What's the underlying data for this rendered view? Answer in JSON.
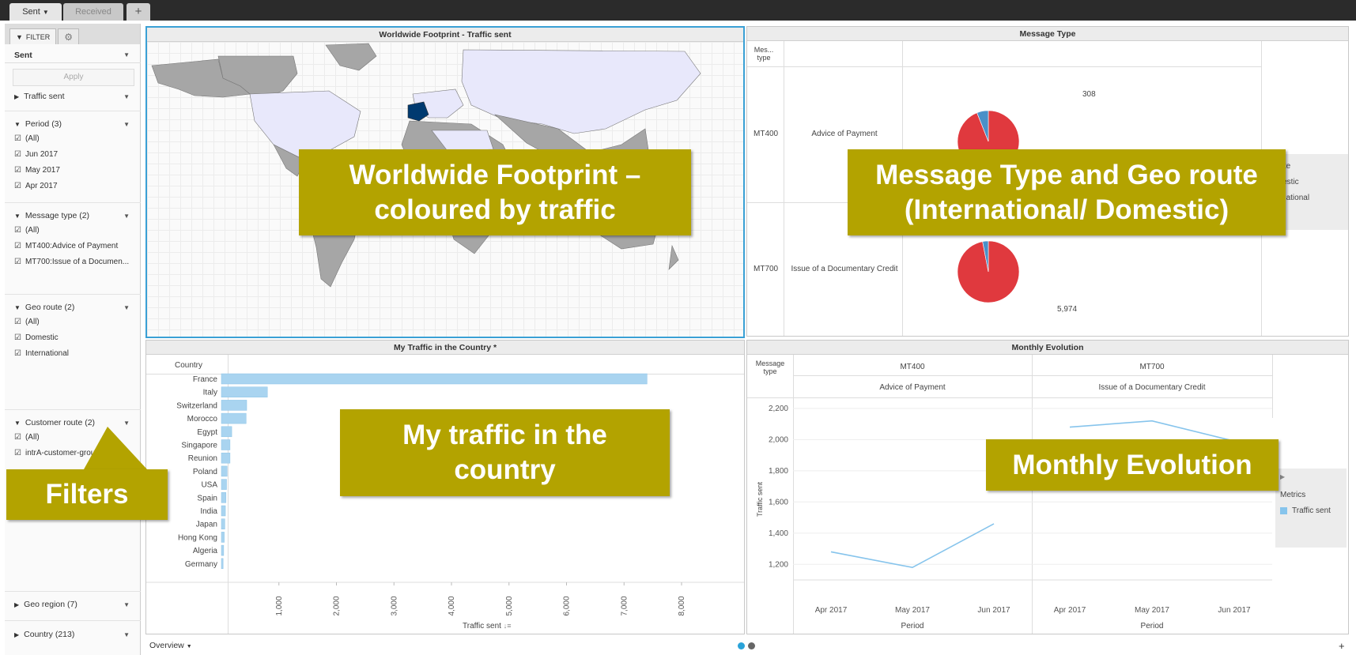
{
  "tabs": {
    "sent": "Sent",
    "received": "Received",
    "add": "+"
  },
  "filter_panel": {
    "tab_label": "FILTER",
    "selector_value": "Sent",
    "apply_label": "Apply",
    "traffic_sent": "Traffic sent",
    "period": {
      "title": "Period (3)",
      "items": [
        "(All)",
        "Jun 2017",
        "May 2017",
        "Apr 2017"
      ]
    },
    "message_type": {
      "title": "Message type (2)",
      "items": [
        "(All)",
        "MT400:Advice of Payment",
        "MT700:Issue of a Documen..."
      ]
    },
    "geo_route": {
      "title": "Geo route (2)",
      "items": [
        "(All)",
        "Domestic",
        "International"
      ]
    },
    "customer_route": {
      "title": "Customer route (2)",
      "items": [
        "(All)",
        "intrA-customer-group"
      ]
    },
    "geo_region": "Geo region (7)",
    "country": "Country (213)"
  },
  "map_panel": {
    "title": "Worldwide Footprint - Traffic sent",
    "highlight_color": "#003a70",
    "land_color": "#a6a6a6",
    "visited_color": "#e8e8fb"
  },
  "message_panel": {
    "title": "Message Type",
    "col_header": "Mes... type",
    "rows": [
      {
        "code": "MT400",
        "name": "Advice of Payment",
        "label": "308"
      },
      {
        "code": "MT700",
        "name": "Issue of a Documentary Credit",
        "label": "5,974"
      }
    ],
    "legend_title": "o route",
    "legend": [
      "Domestic",
      "International"
    ],
    "colors": {
      "international": "#e0393e",
      "domestic": "#4a90c8"
    }
  },
  "country_panel": {
    "title": "My Traffic in the Country *",
    "col_header": "Country",
    "x_title": "Traffic sent",
    "sort_icon": "↓≡",
    "bar_color": "#a9d4f0"
  },
  "monthly_panel": {
    "title": "Monthly Evolution",
    "col_header": "Message type",
    "groups": [
      {
        "code": "MT400",
        "name": "Advice of Payment"
      },
      {
        "code": "MT700",
        "name": "Issue of a Documentary Credit"
      }
    ],
    "y_title": "Traffic sent",
    "period_label": "Period",
    "legend_title": "Metrics",
    "legend_item": "Traffic sent",
    "line_color": "#86c4ec"
  },
  "callouts": {
    "map": "Worldwide Footprint – coloured by traffic",
    "message": "Message Type and Geo route (International/ Domestic)",
    "country": "My traffic in the country",
    "monthly": "Monthly Evolution",
    "filters": "Filters"
  },
  "footer": {
    "overview": "Overview",
    "add": "+"
  },
  "chart_data": [
    {
      "type": "bar",
      "title": "My Traffic in the Country *",
      "xlabel": "Traffic sent",
      "ylabel": "Country",
      "orientation": "horizontal",
      "categories": [
        "France",
        "Italy",
        "Switzerland",
        "Morocco",
        "Egypt",
        "Singapore",
        "Reunion",
        "Poland",
        "USA",
        "Spain",
        "India",
        "Japan",
        "Hong Kong",
        "Algeria",
        "Germany"
      ],
      "values": [
        7400,
        800,
        440,
        430,
        180,
        150,
        150,
        100,
        90,
        80,
        70,
        60,
        50,
        40,
        30
      ],
      "xlim": [
        0,
        8000
      ],
      "xticks": [
        "1,000",
        "2,000",
        "3,000",
        "4,000",
        "5,000",
        "6,000",
        "7,000",
        "8,000"
      ]
    },
    {
      "type": "line",
      "title": "Monthly Evolution",
      "ylabel": "Traffic sent",
      "xlabel": "Period",
      "ylim": [
        1100,
        2250
      ],
      "yticks": [
        "1,200",
        "1,400",
        "1,600",
        "1,800",
        "2,000",
        "2,200"
      ],
      "categories": [
        "Apr 2017",
        "May 2017",
        "Jun 2017"
      ],
      "series": [
        {
          "name": "MT400",
          "values": [
            1280,
            1180,
            1460
          ]
        },
        {
          "name": "MT700",
          "values": [
            2080,
            2120,
            1990
          ]
        }
      ]
    },
    {
      "type": "pie",
      "title": "Message Type",
      "series": [
        {
          "name": "MT400",
          "slices": [
            {
              "label": "International",
              "value": 94
            },
            {
              "label": "Domestic",
              "value": 6
            }
          ]
        },
        {
          "name": "MT700",
          "slices": [
            {
              "label": "International",
              "value": 97
            },
            {
              "label": "Domestic",
              "value": 3
            }
          ]
        }
      ]
    }
  ]
}
